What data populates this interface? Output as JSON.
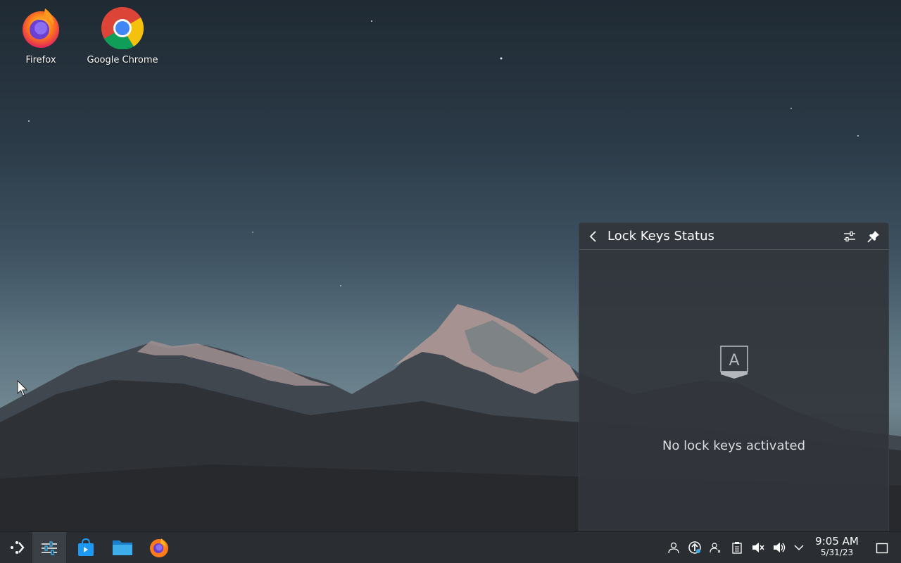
{
  "desktop": {
    "icons": [
      {
        "label": "Firefox",
        "icon": "firefox-icon"
      },
      {
        "label": "Google Chrome",
        "icon": "chrome-icon"
      }
    ]
  },
  "popup": {
    "title": "Lock Keys Status",
    "empty_message": "No lock keys activated",
    "lock_icon_letter": "A",
    "buttons": [
      "back-icon",
      "configure-icon",
      "pin-icon"
    ]
  },
  "taskbar": {
    "launchers": [
      "application-launcher-icon",
      "system-settings-icon",
      "discover-store-icon",
      "file-manager-icon",
      "firefox-icon"
    ],
    "tray": [
      "user-icon",
      "updates-icon",
      "user-switch-icon",
      "clipboard-icon",
      "mute-microphone-icon",
      "volume-icon",
      "expand-tray-icon"
    ],
    "clock": {
      "time": "9:05 AM",
      "date": "5/31/23"
    },
    "show_desktop": "show-desktop-icon"
  },
  "colors": {
    "accent": "#3daee9",
    "panel": "#2a2e32",
    "popup_bg": "#31353b"
  }
}
